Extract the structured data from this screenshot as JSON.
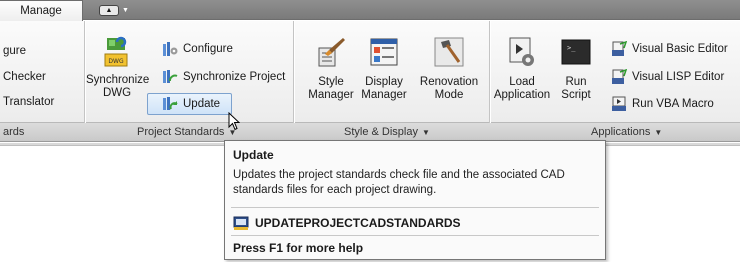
{
  "tabs": {
    "active": "Manage"
  },
  "left_panel": {
    "items": [
      "gure",
      "Checker",
      "Translator"
    ],
    "title": "ards"
  },
  "project_standards": {
    "synchronize_dwg": "Synchronize\nDWG",
    "configure": "Configure",
    "synchronize_project": "Synchronize Project",
    "update": "Update",
    "title": "Project Standards"
  },
  "style_display": {
    "style_manager": "Style\nManager",
    "display_manager": "Display\nManager",
    "renovation_mode": "Renovation\nMode",
    "title": "Style & Display"
  },
  "applications": {
    "load_application": "Load\nApplication",
    "run_script": "Run\nScript",
    "visual_basic_editor": "Visual Basic Editor",
    "visual_lisp_editor": "Visual LISP Editor",
    "run_vba_macro": "Run VBA Macro",
    "title": "Applications"
  },
  "tooltip": {
    "title": "Update",
    "description": "Updates the project standards check file and the associated CAD standards files for each project drawing.",
    "command": "UPDATEPROJECTCADSTANDARDS",
    "help": "Press F1 for more help"
  },
  "colors": {
    "tabbar": "#888888",
    "ribbon": "#f4f4f4",
    "highlight": "#cfe3f8"
  }
}
